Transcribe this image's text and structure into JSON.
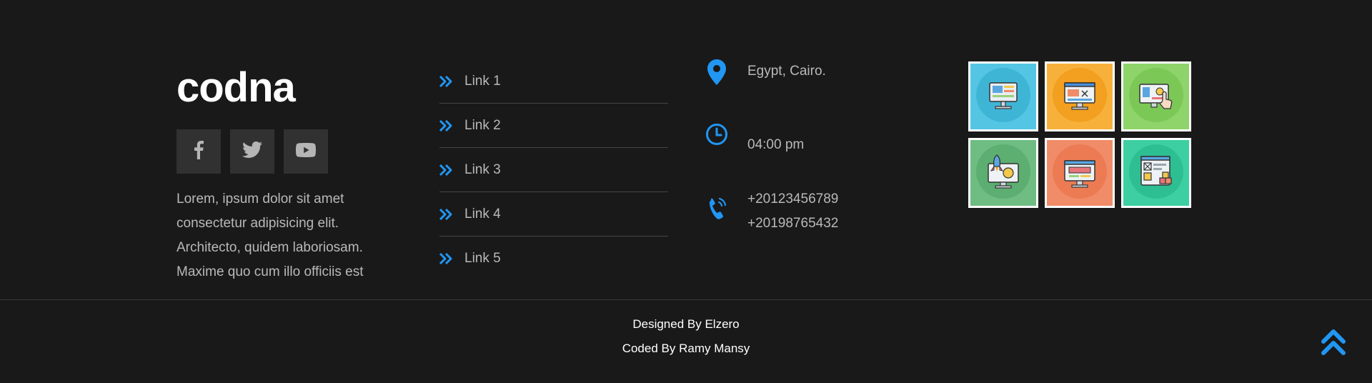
{
  "brand": {
    "name": "codna"
  },
  "social": [
    {
      "icon": "facebook-icon",
      "label": "Facebook"
    },
    {
      "icon": "twitter-icon",
      "label": "Twitter"
    },
    {
      "icon": "youtube-icon",
      "label": "YouTube"
    }
  ],
  "about": {
    "text": "Lorem, ipsum dolor sit amet consectetur adipisicing elit. Architecto, quidem laboriosam. Maxime quo cum illo officiis est"
  },
  "links": [
    {
      "label": "Link 1",
      "icon": "double-chevron-right-icon"
    },
    {
      "label": "Link 2",
      "icon": "double-chevron-right-icon"
    },
    {
      "label": "Link 3",
      "icon": "double-chevron-right-icon"
    },
    {
      "label": "Link 4",
      "icon": "double-chevron-right-icon"
    },
    {
      "label": "Link 5",
      "icon": "double-chevron-right-icon"
    }
  ],
  "contact": {
    "location": {
      "icon": "location-pin-icon",
      "text": "Egypt, Cairo."
    },
    "hours": {
      "icon": "clock-icon",
      "text": "04:00 pm"
    },
    "phones": {
      "icon": "phone-icon",
      "numbers": [
        "+20123456789",
        "+20198765432"
      ]
    }
  },
  "gallery": [
    {
      "icon": "web-monitor-illustration",
      "bg": "#54c6e4"
    },
    {
      "icon": "web-design-illustration",
      "bg": "#f7b13b"
    },
    {
      "icon": "touch-screen-illustration",
      "bg": "#8ed46a"
    },
    {
      "icon": "rocket-launch-illustration",
      "bg": "#6fbd82"
    },
    {
      "icon": "desktop-browser-illustration",
      "bg": "#f08c68"
    },
    {
      "icon": "ui-wireframe-illustration",
      "bg": "#3dcfa2"
    }
  ],
  "copyright": {
    "designed": "Designed By Elzero",
    "coded": "Coded By Ramy Mansy"
  },
  "colors": {
    "background": "#191919",
    "accent": "#2196f3",
    "text": "#b9b9b9",
    "social_bg": "#313131"
  },
  "scroll_top": {
    "icon": "double-chevron-up-icon"
  }
}
